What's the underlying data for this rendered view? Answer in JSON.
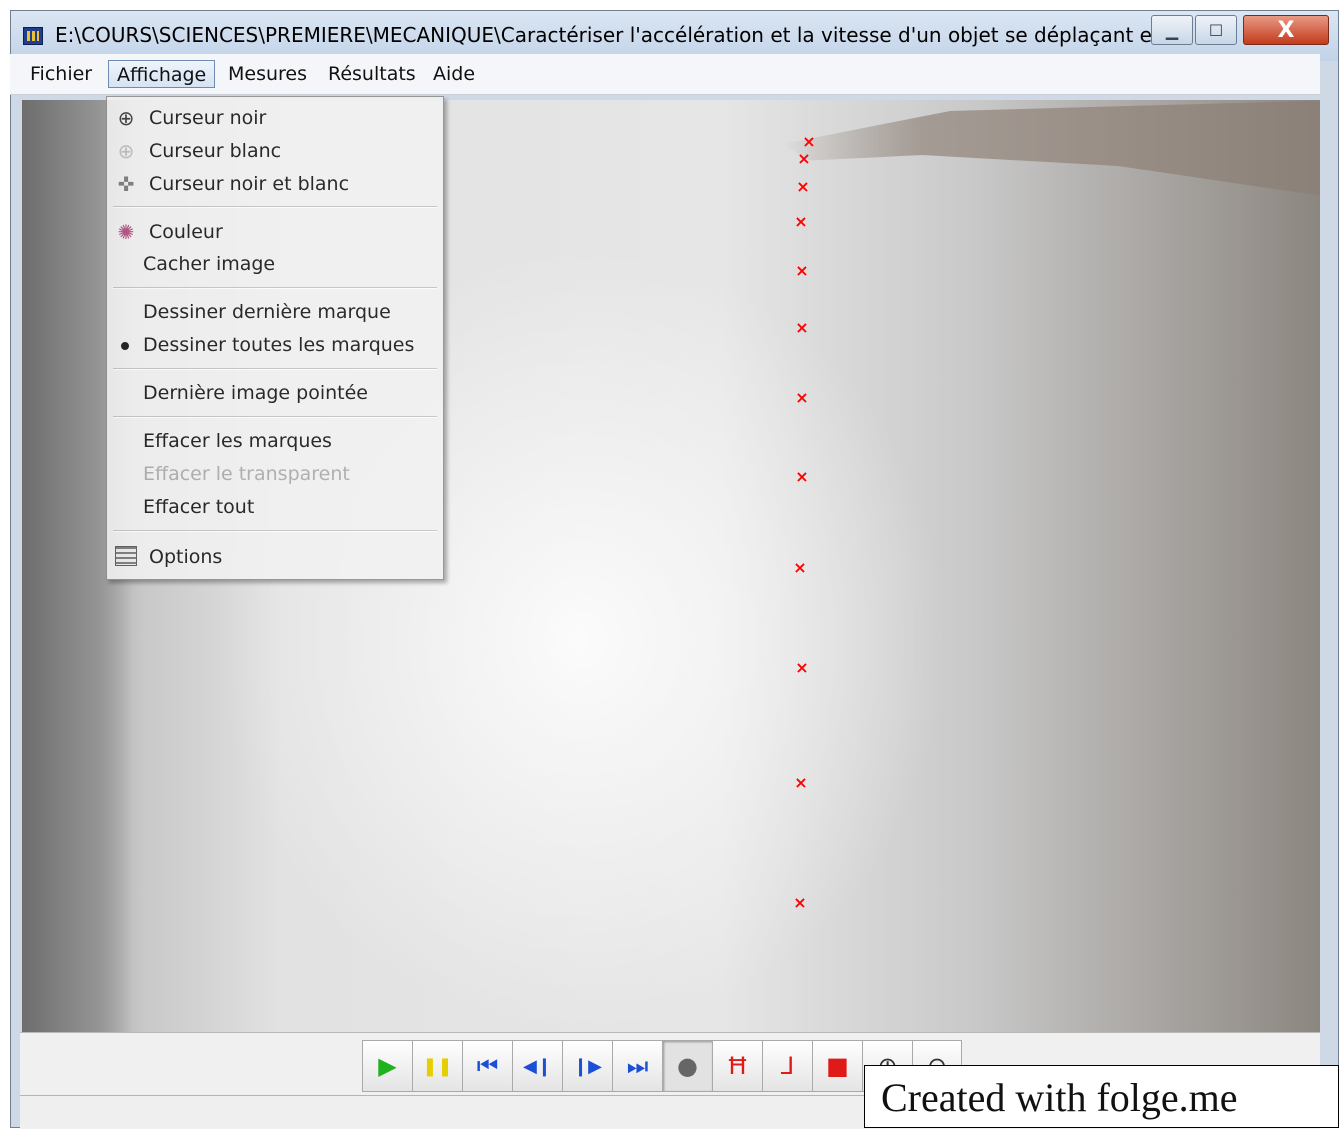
{
  "window": {
    "title": "E:\\COURS\\SCIENCES\\PREMIERE\\MECANIQUE\\Caractériser l'accélération et la vitesse d'un objet se déplaçant en ligne ...",
    "controls": {
      "minimize": "▁",
      "maximize": "☐",
      "close": "X"
    }
  },
  "menubar": {
    "items": [
      "Fichier",
      "Affichage",
      "Mesures",
      "Résultats",
      "Aide"
    ],
    "active": "Affichage"
  },
  "affichage_menu": {
    "items": [
      {
        "label": "Curseur noir",
        "icon": "crosshair-black-icon"
      },
      {
        "label": "Curseur blanc",
        "icon": "crosshair-white-icon"
      },
      {
        "label": "Curseur noir et blanc",
        "icon": "crosshair-bw-icon"
      },
      {
        "label": "Couleur",
        "icon": "palette-icon"
      },
      {
        "label": "Cacher image"
      },
      {
        "label": "Dessiner dernière marque"
      },
      {
        "label": "Dessiner toutes les marques",
        "checked": true
      },
      {
        "label": "Dernière image pointée"
      },
      {
        "label": "Effacer les marques"
      },
      {
        "label": "Effacer le transparent",
        "disabled": true
      },
      {
        "label": "Effacer tout"
      },
      {
        "label": "Options",
        "icon": "options-icon"
      }
    ]
  },
  "markers": {
    "symbol": "×",
    "color": "#ff0000",
    "count": 13
  },
  "toolbar": {
    "buttons": [
      {
        "name": "play-button",
        "icon": "play-icon",
        "glyph": "▶",
        "color": "#1fb21f"
      },
      {
        "name": "pause-button",
        "icon": "pause-icon",
        "glyph": "❚❚",
        "color": "#e6cf00"
      },
      {
        "name": "first-frame-button",
        "icon": "first-frame-icon",
        "glyph": "⏮",
        "color": "#1a4fd6"
      },
      {
        "name": "prev-frame-button",
        "icon": "prev-frame-icon",
        "glyph": "◀❙",
        "color": "#1a4fd6"
      },
      {
        "name": "next-frame-button",
        "icon": "next-frame-icon",
        "glyph": "❙▶",
        "color": "#1a4fd6"
      },
      {
        "name": "last-frame-button",
        "icon": "last-frame-icon",
        "glyph": "⏭",
        "color": "#1a4fd6"
      },
      {
        "name": "point-mode-button",
        "icon": "point-icon",
        "glyph": "●",
        "color": "#666666",
        "pressed": true
      },
      {
        "name": "scale-button",
        "icon": "scale-icon",
        "glyph": "Ħ",
        "color": "#e01919"
      },
      {
        "name": "axes-button",
        "icon": "axes-icon",
        "glyph": "⅃",
        "color": "#e01919"
      },
      {
        "name": "transparent-button",
        "icon": "transparent-icon",
        "glyph": "■",
        "color": "#e01919"
      },
      {
        "name": "zoom-in-button",
        "icon": "zoom-in-icon",
        "glyph": "⊕",
        "color": "#333333"
      },
      {
        "name": "zoom-out-button",
        "icon": "zoom-out-icon",
        "glyph": "⊖",
        "color": "#333333"
      }
    ]
  },
  "watermark": "Created with folge.me"
}
